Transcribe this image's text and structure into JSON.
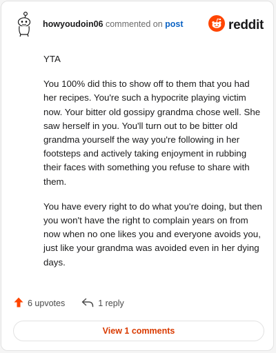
{
  "header": {
    "username": "howyoudoin06",
    "action_text": "commented on",
    "post_link": "post",
    "brand": "reddit"
  },
  "comment": {
    "paragraphs": [
      "YTA",
      "You 100% did this to show off to them that you had her recipes. You're such a hypocrite playing victim now. Your bitter old gossipy grandma chose well. She saw herself in you. You'll turn out to be bitter old grandma yourself the way you're following in her footsteps and actively taking enjoyment in rubbing their faces with something you refuse to share with them.",
      "You have every right to do what you're doing, but then you won't have the right to complain years on from now when no one likes you and everyone avoids you, just like your grandma was avoided even in her dying days."
    ]
  },
  "actions": {
    "upvotes_label": "6 upvotes",
    "reply_label": "1 reply"
  },
  "view_comments_label": "View 1 comments",
  "colors": {
    "brand_orange": "#ff4500",
    "link_blue": "#0b63c4",
    "button_text": "#d93a00"
  },
  "icons": {
    "avatar": "snoo-avatar-icon",
    "brand": "reddit-logo-icon",
    "upvote": "upvote-arrow-icon",
    "reply": "reply-arrow-icon"
  }
}
